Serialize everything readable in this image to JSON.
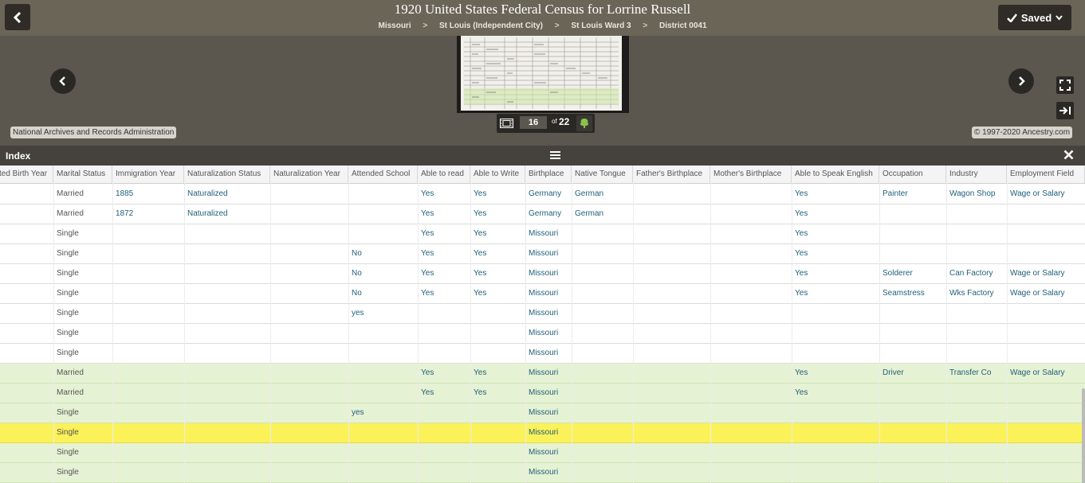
{
  "header": {
    "title": "1920 United States Federal Census for Lorrine Russell",
    "breadcrumb": [
      "Missouri",
      "St Louis (Independent City)",
      "St Louis Ward 3",
      "District 0041"
    ],
    "separator": ">",
    "saved_label": "Saved",
    "icons": {
      "back": "chevron-left-icon",
      "saved": "check-icon",
      "dropdown": "chevron-down-icon"
    }
  },
  "viewer": {
    "page_current": "16",
    "page_of": "of",
    "page_total": "22",
    "credit_left": "National Archives and Records Administration",
    "credit_right": "© 1997-2020 Ancestry.com",
    "icons": [
      "filmstrip-icon",
      "tree-icon",
      "fullscreen-icon",
      "panel-toggle-icon",
      "prev-image-icon",
      "next-image-icon"
    ]
  },
  "index": {
    "title": "Index",
    "icons": {
      "menu": "menu-icon",
      "close": "close-icon"
    }
  },
  "table": {
    "columns": [
      "ted Birth Year",
      "Marital Status",
      "Immigration Year",
      "Naturalization Status",
      "Naturalization Year",
      "Attended School",
      "Able to read",
      "Able to Write",
      "Birthplace",
      "Native Tongue",
      "Father's Birthplace",
      "Mother's Birthplace",
      "Able to Speak English",
      "Occupation",
      "Industry",
      "Employment Field"
    ],
    "rows": [
      {
        "style": "white",
        "cells": [
          "",
          "Married",
          "1885",
          "Naturalized",
          "",
          "",
          "Yes",
          "Yes",
          "Germany",
          "German",
          "",
          "",
          "Yes",
          "Painter",
          "Wagon Shop",
          "Wage or Salary"
        ]
      },
      {
        "style": "white",
        "cells": [
          "",
          "Married",
          "1872",
          "Naturalized",
          "",
          "",
          "Yes",
          "Yes",
          "Germany",
          "German",
          "",
          "",
          "Yes",
          "",
          "",
          ""
        ]
      },
      {
        "style": "white",
        "cells": [
          "",
          "Single",
          "",
          "",
          "",
          "",
          "Yes",
          "Yes",
          "Missouri",
          "",
          "",
          "",
          "Yes",
          "",
          "",
          ""
        ]
      },
      {
        "style": "white",
        "cells": [
          "",
          "Single",
          "",
          "",
          "",
          "No",
          "Yes",
          "Yes",
          "Missouri",
          "",
          "",
          "",
          "Yes",
          "",
          "",
          ""
        ]
      },
      {
        "style": "white",
        "cells": [
          "",
          "Single",
          "",
          "",
          "",
          "No",
          "Yes",
          "Yes",
          "Missouri",
          "",
          "",
          "",
          "Yes",
          "Solderer",
          "Can Factory",
          "Wage or Salary"
        ]
      },
      {
        "style": "white",
        "cells": [
          "",
          "Single",
          "",
          "",
          "",
          "No",
          "Yes",
          "Yes",
          "Missouri",
          "",
          "",
          "",
          "Yes",
          "Seamstress",
          "Wks Factory",
          "Wage or Salary"
        ]
      },
      {
        "style": "white",
        "cells": [
          "",
          "Single",
          "",
          "",
          "",
          "yes",
          "",
          "",
          "Missouri",
          "",
          "",
          "",
          "",
          "",
          "",
          ""
        ]
      },
      {
        "style": "white",
        "cells": [
          "",
          "Single",
          "",
          "",
          "",
          "",
          "",
          "",
          "Missouri",
          "",
          "",
          "",
          "",
          "",
          "",
          ""
        ]
      },
      {
        "style": "white",
        "cells": [
          "",
          "Single",
          "",
          "",
          "",
          "",
          "",
          "",
          "Missouri",
          "",
          "",
          "",
          "",
          "",
          "",
          ""
        ]
      },
      {
        "style": "green",
        "cells": [
          "",
          "Married",
          "",
          "",
          "",
          "",
          "Yes",
          "Yes",
          "Missouri",
          "",
          "",
          "",
          "Yes",
          "Driver",
          "Transfer Co",
          "Wage or Salary"
        ]
      },
      {
        "style": "green",
        "cells": [
          "",
          "Married",
          "",
          "",
          "",
          "",
          "Yes",
          "Yes",
          "Missouri",
          "",
          "",
          "",
          "Yes",
          "",
          "",
          ""
        ]
      },
      {
        "style": "green",
        "cells": [
          "",
          "Single",
          "",
          "",
          "",
          "yes",
          "",
          "",
          "Missouri",
          "",
          "",
          "",
          "",
          "",
          "",
          ""
        ]
      },
      {
        "style": "highlight",
        "cells": [
          "",
          "Single",
          "",
          "",
          "",
          "",
          "",
          "",
          "Missouri",
          "",
          "",
          "",
          "",
          "",
          "",
          ""
        ]
      },
      {
        "style": "green",
        "cells": [
          "",
          "Single",
          "",
          "",
          "",
          "",
          "",
          "",
          "Missouri",
          "",
          "",
          "",
          "",
          "",
          "",
          ""
        ]
      },
      {
        "style": "green",
        "cells": [
          "",
          "Single",
          "",
          "",
          "",
          "",
          "",
          "",
          "Missouri",
          "",
          "",
          "",
          "",
          "",
          "",
          ""
        ]
      }
    ]
  },
  "colors": {
    "header_bg": "#6b6558",
    "viewer_bg": "#5b574f",
    "index_bar_bg": "#45423d",
    "household_row_bg": "#e6f2d4",
    "selected_row_bg": "#fbf25a",
    "link_text": "#1f5f7a"
  }
}
